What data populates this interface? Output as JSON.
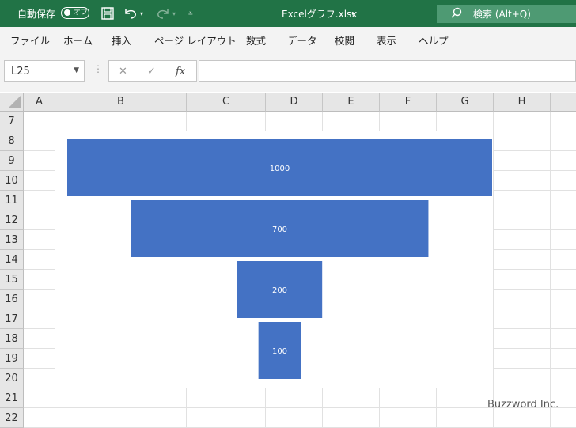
{
  "titlebar": {
    "autosave_label": "自動保存",
    "autosave_state": "オフ",
    "filename": "Excelグラフ.xlsx",
    "search_label": "検索 (Alt+Q)"
  },
  "ribbon": {
    "tabs": [
      "ファイル",
      "ホーム",
      "挿入",
      "ページ レイアウト",
      "数式",
      "データ",
      "校閲",
      "表示",
      "ヘルプ"
    ]
  },
  "formula_bar": {
    "name_box": "L25",
    "fx": "fx",
    "content": ""
  },
  "sheet": {
    "columns": [
      "A",
      "B",
      "C",
      "D",
      "E",
      "F",
      "G",
      "H"
    ],
    "rows": [
      "7",
      "8",
      "9",
      "10",
      "11",
      "12",
      "13",
      "14",
      "15",
      "16",
      "17",
      "18",
      "19",
      "20",
      "21",
      "22"
    ]
  },
  "chart_data": {
    "type": "bar",
    "subtype": "funnel",
    "color": "#4472c4",
    "values": [
      1000,
      700,
      200,
      100
    ],
    "data_labels": [
      "1000",
      "700",
      "200",
      "100"
    ]
  },
  "watermark": "Buzzword Inc.",
  "colors": {
    "titlebar": "#217346",
    "bar": "#4472c4"
  }
}
